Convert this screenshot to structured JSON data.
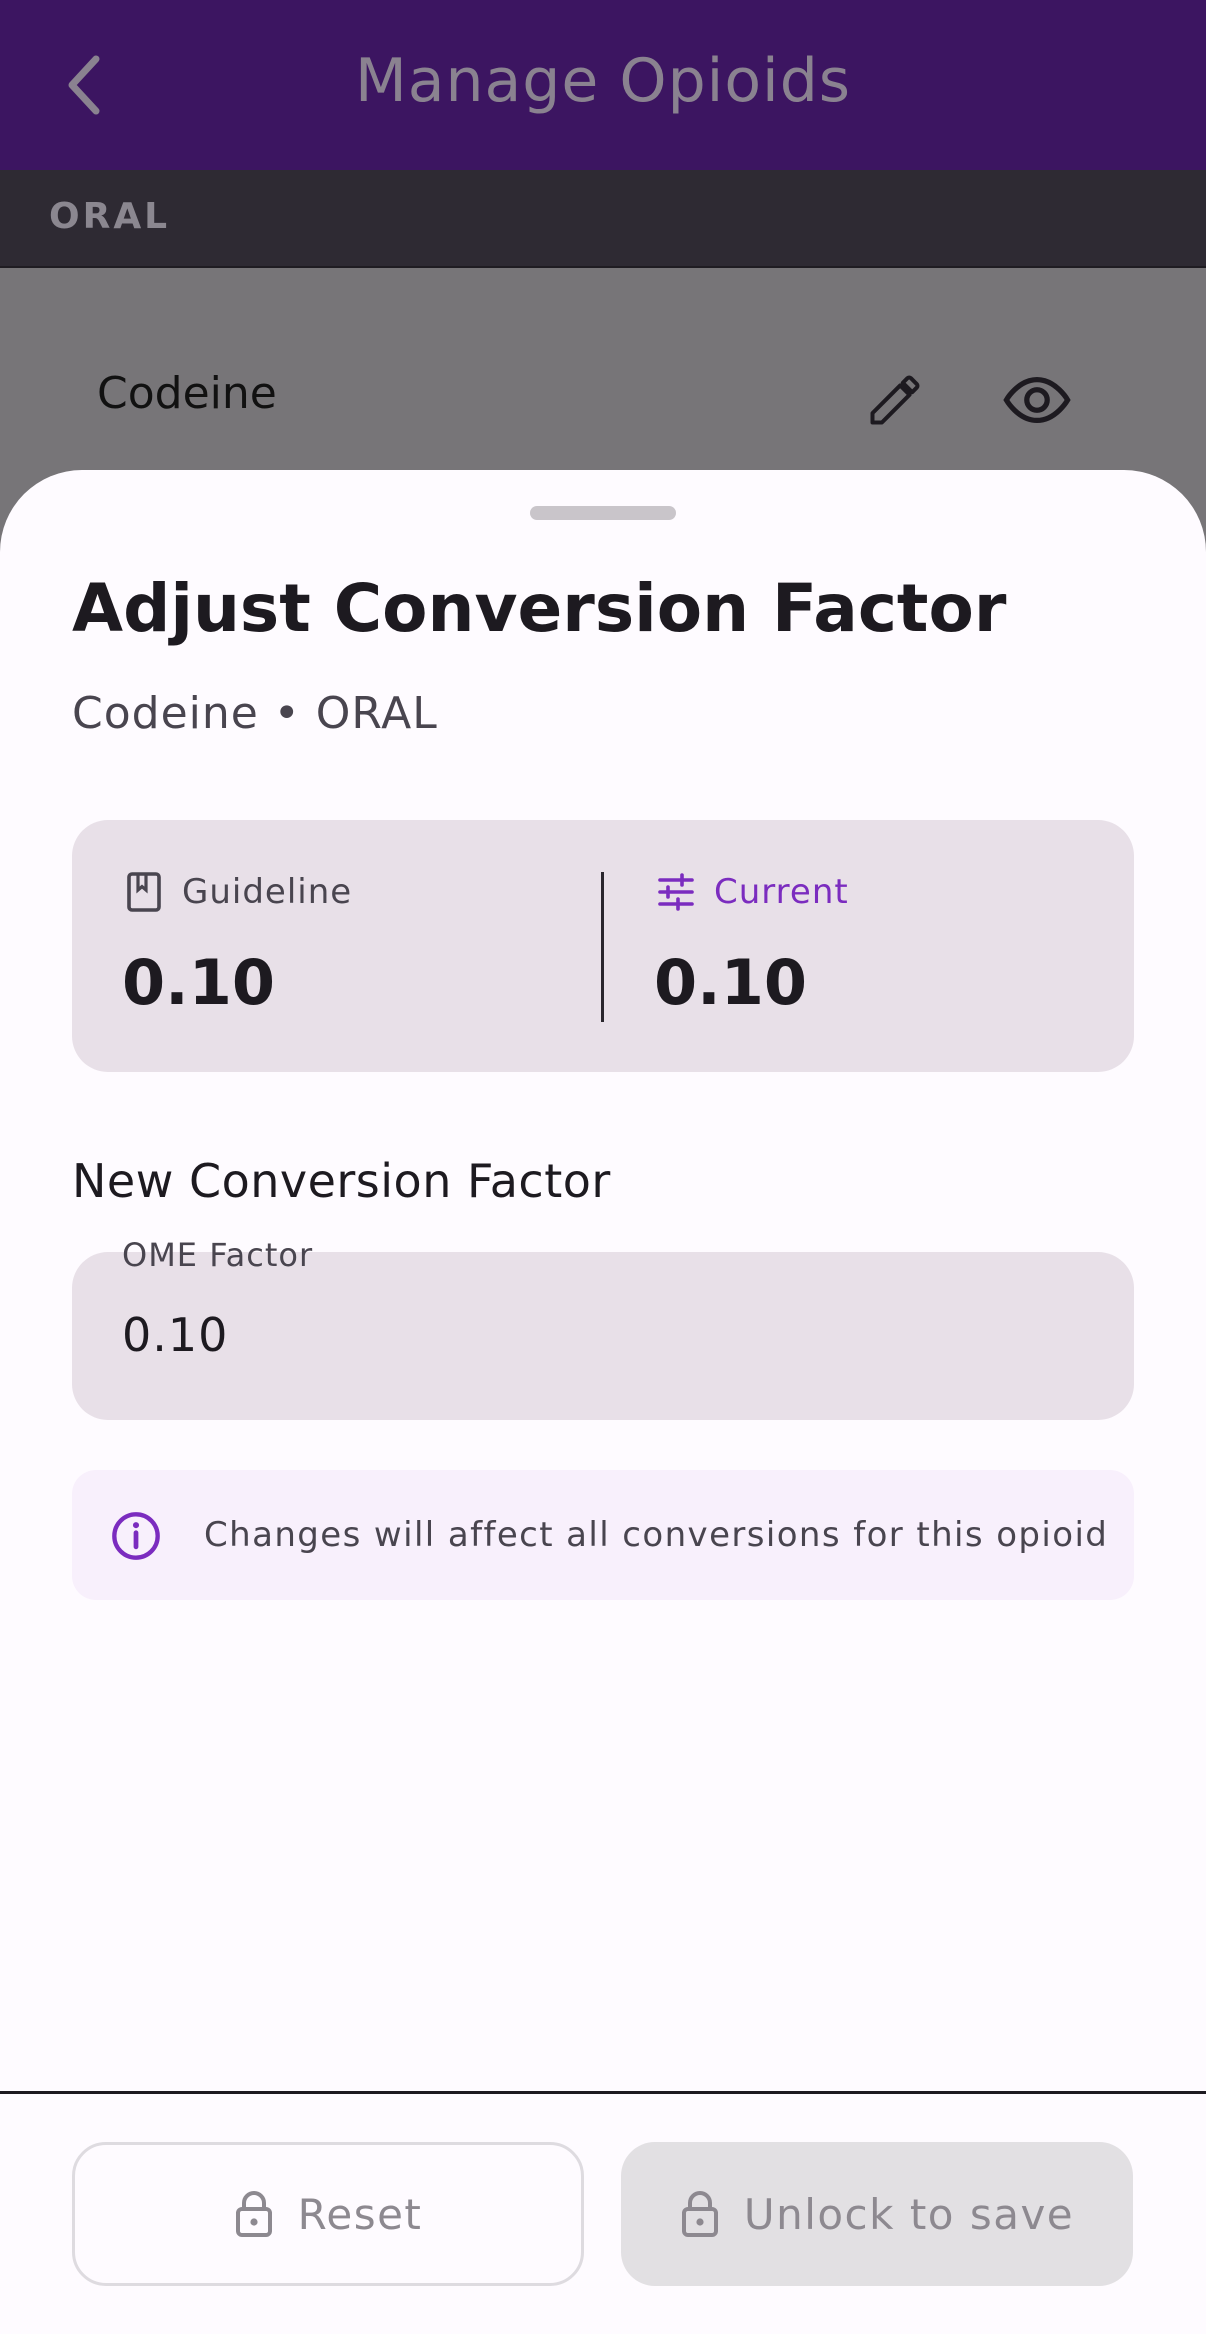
{
  "app": {
    "title": "Manage Opioids",
    "back_icon": "chevron-left-icon"
  },
  "list": {
    "section_label": "ORAL",
    "rows": [
      {
        "name": "Codeine",
        "actions": [
          "edit-icon",
          "eye-icon"
        ]
      }
    ]
  },
  "sheet": {
    "title": "Adjust Conversion Factor",
    "subtitle": "Codeine • ORAL",
    "guideline": {
      "label": "Guideline",
      "value": "0.10",
      "icon": "bookmark-icon"
    },
    "current": {
      "label": "Current",
      "value": "0.10",
      "icon": "tune-icon"
    },
    "new_factor_heading": "New Conversion Factor",
    "input": {
      "label": "OME Factor",
      "value": "0.10"
    },
    "notice": {
      "icon": "info-icon",
      "text": "Changes will affect all conversions for this opioid"
    },
    "buttons": {
      "reset": "Reset",
      "save": "Unlock to save",
      "icon": "lock-icon"
    }
  },
  "colors": {
    "app_bar": "#3c1561",
    "accent": "#7b2cbf",
    "scrim": "#777578",
    "sheet_bg": "#fefbff",
    "card_bg": "#e8e0e8"
  }
}
